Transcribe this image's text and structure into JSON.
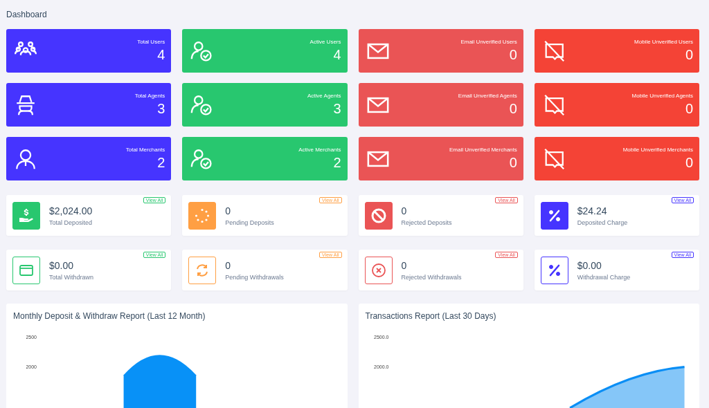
{
  "page_title": "Dashboard",
  "stat_cards": [
    {
      "label": "Total Users",
      "value": "4",
      "color": "#4634ff"
    },
    {
      "label": "Active Users",
      "value": "4",
      "color": "#28c76f"
    },
    {
      "label": "Email Unverified Users",
      "value": "0",
      "color": "#ea5455"
    },
    {
      "label": "Mobile Unverified Users",
      "value": "0",
      "color": "#f44336"
    },
    {
      "label": "Total Agents",
      "value": "3",
      "color": "#4634ff"
    },
    {
      "label": "Active Agents",
      "value": "3",
      "color": "#28c76f"
    },
    {
      "label": "Email Unverified Agents",
      "value": "0",
      "color": "#ea5455"
    },
    {
      "label": "Mobile Unverified Agents",
      "value": "0",
      "color": "#f44336"
    },
    {
      "label": "Total Merchants",
      "value": "2",
      "color": "#4634ff"
    },
    {
      "label": "Active Merchants",
      "value": "2",
      "color": "#28c76f"
    },
    {
      "label": "Email Unverified Merchants",
      "value": "0",
      "color": "#ea5455"
    },
    {
      "label": "Mobile Unverified Merchants",
      "value": "0",
      "color": "#f44336"
    }
  ],
  "widgets": [
    {
      "value": "$2,024.00",
      "label": "Total Deposited",
      "link": "View All",
      "kind": "solid",
      "color": "#28c76f"
    },
    {
      "value": "0",
      "label": "Pending Deposits",
      "link": "View All",
      "kind": "solid",
      "color": "#ff9f43"
    },
    {
      "value": "0",
      "label": "Rejected Deposits",
      "link": "View All",
      "kind": "solid",
      "color": "#ea5455"
    },
    {
      "value": "$24.24",
      "label": "Deposited Charge",
      "link": "View All",
      "kind": "solid",
      "color": "#4634ff"
    },
    {
      "value": "$0.00",
      "label": "Total Withdrawn",
      "link": "View All",
      "kind": "outline",
      "color": "#28c76f"
    },
    {
      "value": "0",
      "label": "Pending Withdrawals",
      "link": "View All",
      "kind": "outline",
      "color": "#ff9f43"
    },
    {
      "value": "0",
      "label": "Rejected Withdrawals",
      "link": "View All",
      "kind": "outline",
      "color": "#ea5455"
    },
    {
      "value": "$0.00",
      "label": "Withdrawal Charge",
      "link": "View All",
      "kind": "outline",
      "color": "#4634ff"
    }
  ],
  "charts": [
    {
      "title": "Monthly Deposit & Withdraw Report (Last 12 Month)",
      "y_ticks": [
        "2500",
        "2000"
      ]
    },
    {
      "title": "Transactions Report (Last 30 Days)",
      "y_ticks": [
        "2500.0",
        "2000.0"
      ]
    }
  ]
}
